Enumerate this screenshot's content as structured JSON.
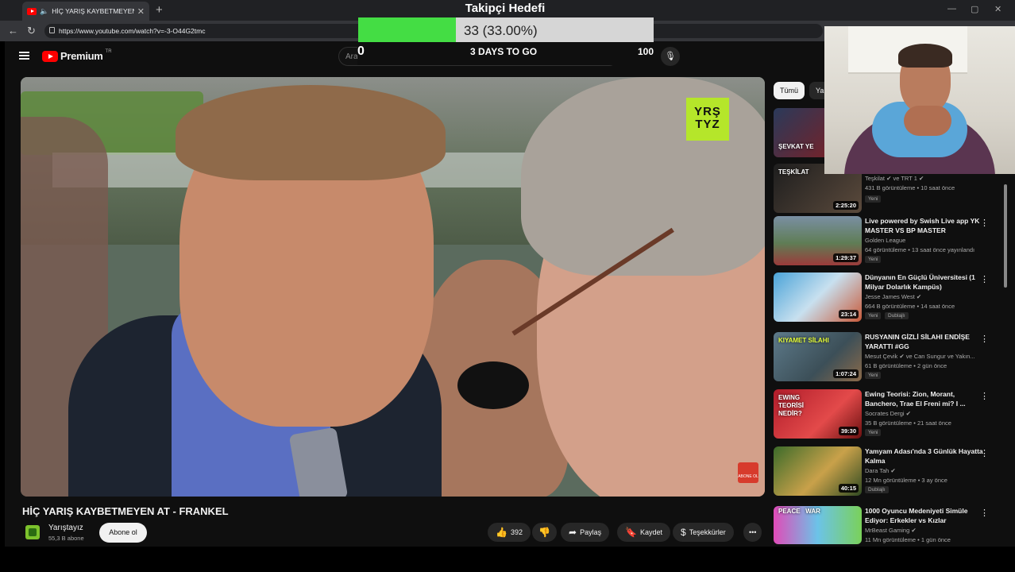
{
  "browser": {
    "tab_title": "HİÇ YARIŞ KAYBETMEYEN AT - ...",
    "url": "https://www.youtube.com/watch?v=-3-O44G2tmc"
  },
  "header": {
    "logo_text": "Premium",
    "logo_region": "TR",
    "search_placeholder": "Ara"
  },
  "video": {
    "watermark": "YRŞ TYZ",
    "corner_badge": "ABONE OL",
    "title": "HİÇ YARIŞ KAYBETMEYEN AT - FRANKEL",
    "channel": "Yarıştayız",
    "subscribers": "55,3 B abone",
    "subscribe_label": "Abone ol",
    "likes": "392",
    "share_label": "Paylaş",
    "save_label": "Kaydet",
    "thanks_label": "Teşekkürler",
    "more_label": "•••"
  },
  "sidebar": {
    "chips": [
      "Tümü",
      "Ya"
    ],
    "items": [
      {
        "thumb_label": "ŞEVKAT YE",
        "title": "",
        "channel": "",
        "meta": "",
        "duration": "",
        "badge": "",
        "badge2": ""
      },
      {
        "thumb_label": "TEŞKİLAT",
        "title": "",
        "channel": "Teşkilat ✔ ve TRT 1 ✔",
        "meta": "431 B görüntüleme • 10 saat önce",
        "duration": "2:25:20",
        "badge": "Yeni",
        "badge2": ""
      },
      {
        "thumb_label": "",
        "title": "Live powered by Swish Live app YK MASTER VS BP MASTER",
        "channel": "Golden League",
        "meta": "64 görüntüleme • 13 saat önce yayınlandı",
        "duration": "1:29:37",
        "badge": "Yeni",
        "badge2": ""
      },
      {
        "thumb_label": "",
        "title": "Dünyanın En Güçlü Üniversitesi (1 Milyar Dolarlık Kampüs)",
        "channel": "Jesse James West ✔",
        "meta": "664 B görüntüleme • 14 saat önce",
        "duration": "23:14",
        "badge": "Yeni",
        "badge2": "Dublajlı"
      },
      {
        "thumb_label": "KIYAMET SİLAHI",
        "title": "RUSYANIN GİZLİ SİLAHI ENDİŞE YARATTI #GG",
        "channel": "Mesut Çevik ✔ ve Can Sungur ve Yakın...",
        "meta": "61 B görüntüleme • 2 gün önce",
        "duration": "1:07:24",
        "badge": "Yeni",
        "badge2": ""
      },
      {
        "thumb_label": "EWING TEORİSİ NEDİR?",
        "title": "Ewing Teorisi: Zion, Morant, Banchero, Trae El Freni mi? I ...",
        "channel": "Socrates Dergi ✔",
        "meta": "35 B görüntüleme • 21 saat önce",
        "duration": "39:30",
        "badge": "Yeni",
        "badge2": ""
      },
      {
        "thumb_label": "",
        "title": "Yamyam Adası'nda 3 Günlük Hayatta Kalma",
        "channel": "Dara Tah ✔",
        "meta": "12 Mn görüntüleme • 3 ay önce",
        "duration": "40:15",
        "badge": "Dublajlı",
        "badge2": ""
      },
      {
        "thumb_label": "PEACE   WAR",
        "title": "1000 Oyuncu Medeniyeti Simüle Ediyor: Erkekler vs Kızlar",
        "channel": "MrBeast Gaming ✔",
        "meta": "11 Mn görüntüleme • 1 gün önce",
        "duration": "",
        "badge": "",
        "badge2": ""
      }
    ]
  },
  "overlay": {
    "goal_title": "Takipçi Hedefi",
    "goal_text": "33 (33.00%)",
    "goal_progress": 0.33,
    "goal_min": "0",
    "goal_days": "3 DAYS TO GO",
    "goal_max": "100"
  },
  "colors": {
    "youtube_red": "#ff0000",
    "goal_green": "#44dd44",
    "background": "#0f0f0f"
  },
  "icons": [
    "menu-icon",
    "search-icon",
    "mic-icon",
    "like-icon",
    "dislike-icon",
    "share-icon",
    "save-icon",
    "thanks-icon",
    "more-icon",
    "kebab-icon"
  ]
}
